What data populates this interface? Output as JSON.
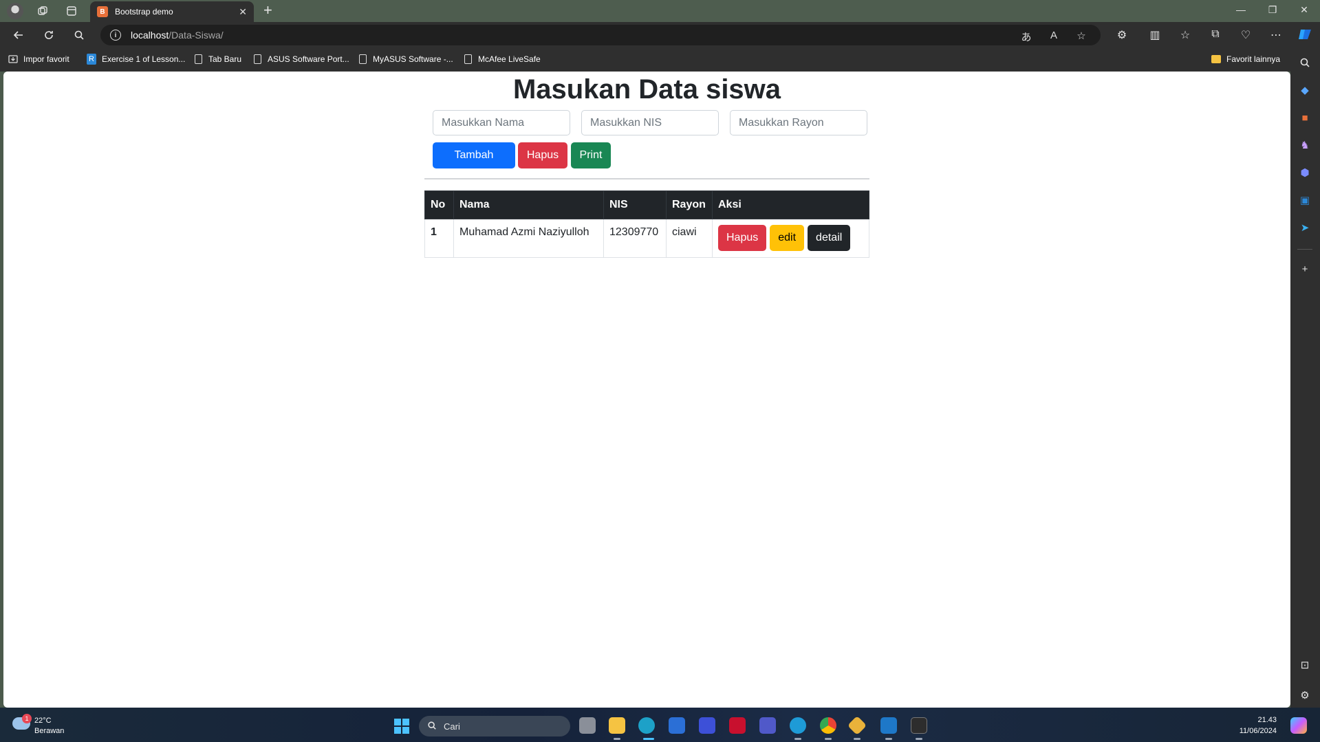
{
  "browser": {
    "tab_title": "Bootstrap demo",
    "tab_favicon_text": "B",
    "close_glyph": "✕",
    "new_tab_glyph": "+",
    "url_host": "localhost",
    "url_path": "/Data-Siswa/",
    "info_glyph": "i",
    "window_controls": {
      "minimize": "—",
      "restore": "❐",
      "close": "✕"
    }
  },
  "bookmarks": [
    {
      "label": "Impor favorit",
      "icon": "import-icon"
    },
    {
      "label": "Exercise 1 of Lesson...",
      "icon": "app-icon"
    },
    {
      "label": "Tab Baru",
      "icon": "document-icon"
    },
    {
      "label": "ASUS Software Port...",
      "icon": "document-icon"
    },
    {
      "label": "MyASUS Software -...",
      "icon": "document-icon"
    },
    {
      "label": "McAfee LiveSafe",
      "icon": "document-icon"
    }
  ],
  "bookmarks_other": {
    "label": "Favorit lainnya",
    "icon": "folder-icon"
  },
  "page": {
    "title": "Masukan Data siswa",
    "inputs": {
      "nama_placeholder": "Masukkan Nama",
      "nis_placeholder": "Masukkan NIS",
      "rayon_placeholder": "Masukkan Rayon"
    },
    "buttons": {
      "tambah": "Tambah",
      "hapus": "Hapus",
      "print": "Print"
    },
    "table": {
      "headers": [
        "No",
        "Nama",
        "NIS",
        "Rayon",
        "Aksi"
      ],
      "rows": [
        {
          "no": "1",
          "nama": "Muhamad Azmi Naziyulloh",
          "nis": "12309770",
          "rayon": "ciawi",
          "actions": {
            "hapus": "Hapus",
            "edit": "edit",
            "detail": "detail"
          }
        }
      ]
    }
  },
  "taskbar": {
    "weather_temp": "22°C",
    "weather_desc": "Berawan",
    "weather_badge": "1",
    "search_label": "Cari",
    "time": "21.43",
    "date": "11/06/2024"
  },
  "colors": {
    "primary": "#0d6efd",
    "danger": "#dc3545",
    "success": "#198754",
    "warning": "#ffc107",
    "dark": "#212529"
  }
}
